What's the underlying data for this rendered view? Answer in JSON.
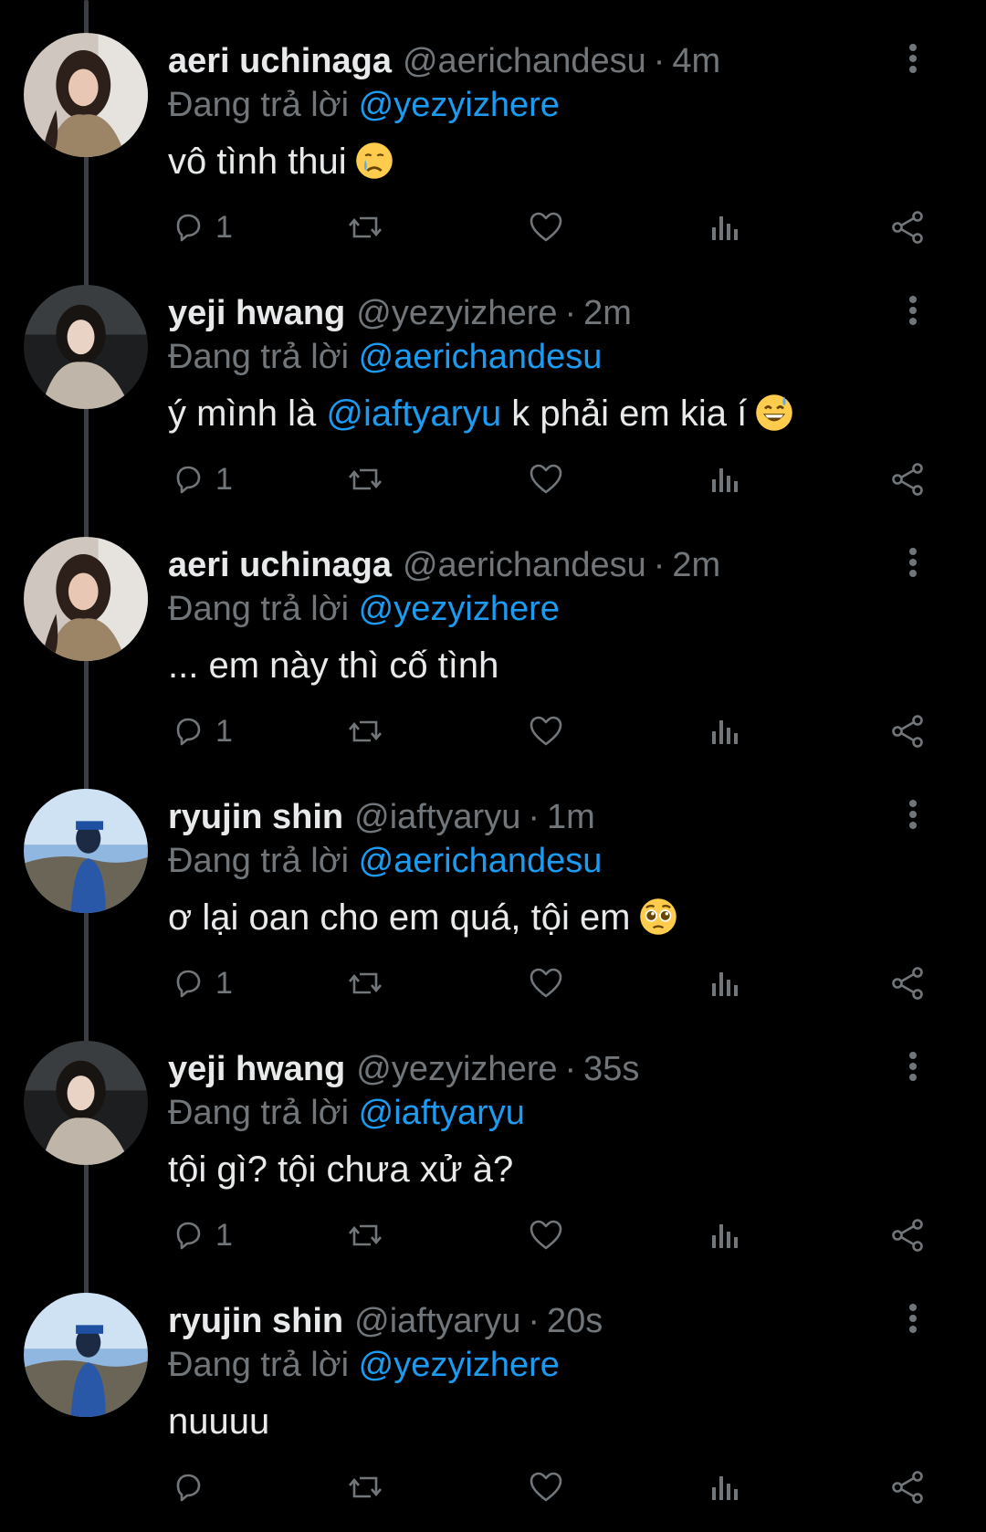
{
  "theme": {
    "background": "#000000",
    "text": "#e7e9ea",
    "secondary": "#71767b",
    "accent": "#1d9bf0"
  },
  "replying_label": "Đang trả lời",
  "tweets": [
    {
      "name": "aeri uchinaga",
      "handle": "@aerichandesu",
      "time": "4m",
      "reply_to": "@yezyizhere",
      "text_before": "vô tình thui",
      "mention": "",
      "text_after": "",
      "emoji": "crying-face",
      "reply_count": "1"
    },
    {
      "name": "yeji hwang",
      "handle": "@yezyizhere",
      "time": "2m",
      "reply_to": "@aerichandesu",
      "text_before": "ý mình là ",
      "mention": "@iaftyaryu",
      "text_after": " k phải em kia í",
      "emoji": "grinning-sweat-face",
      "reply_count": "1"
    },
    {
      "name": "aeri uchinaga",
      "handle": "@aerichandesu",
      "time": "2m",
      "reply_to": "@yezyizhere",
      "text_before": "... em này thì cố tình",
      "mention": "",
      "text_after": "",
      "emoji": "",
      "reply_count": "1"
    },
    {
      "name": "ryujin shin",
      "handle": "@iaftyaryu",
      "time": "1m",
      "reply_to": "@aerichandesu",
      "text_before": "ơ lại oan cho em quá, tội em",
      "mention": "",
      "text_after": "",
      "emoji": "pleading-face",
      "reply_count": "1"
    },
    {
      "name": "yeji hwang",
      "handle": "@yezyizhere",
      "time": "35s",
      "reply_to": "@iaftyaryu",
      "text_before": "tội gì? tội chưa xử à?",
      "mention": "",
      "text_after": "",
      "emoji": "",
      "reply_count": "1"
    },
    {
      "name": "ryujin shin",
      "handle": "@iaftyaryu",
      "time": "20s",
      "reply_to": "@yezyizhere",
      "text_before": "nuuuu",
      "mention": "",
      "text_after": "",
      "emoji": "",
      "reply_count": ""
    }
  ],
  "icons": [
    "reply-icon",
    "retweet-icon",
    "like-icon",
    "views-icon",
    "share-icon",
    "more-icon"
  ]
}
